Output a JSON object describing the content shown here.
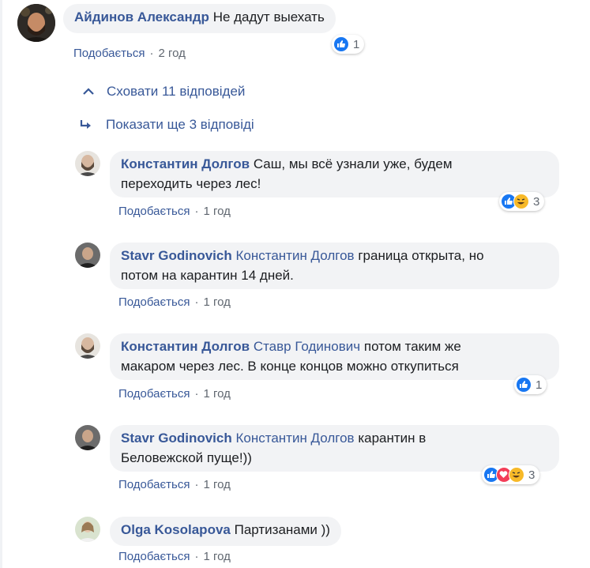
{
  "top_comment": {
    "name": "Айдинов Александр",
    "text": "Не дадут выехать",
    "like_label": "Подобається",
    "time": "2 год",
    "reaction_count": "1"
  },
  "thread": {
    "hide_label": "Сховати 11 відповідей",
    "more_label": "Показати ще 3 відповіді"
  },
  "replies": [
    {
      "name": "Константин Долгов",
      "line1": "Саш, мы всё узнали уже, будем",
      "line2": "переходить через лес!",
      "like_label": "Подобається",
      "time": "1 год",
      "reaction_count": "3"
    },
    {
      "name": "Stavr Godinovich",
      "mention": "Константин Долгов",
      "line1": "граница открыта, но",
      "line2": "потом на карантин 14 дней.",
      "like_label": "Подобається",
      "time": "1 год"
    },
    {
      "name": "Константин Долгов",
      "mention": "Ставр Годинович",
      "line1": "потом таким же",
      "line2": "макаром через лес. В конце концов можно откупиться",
      "like_label": "Подобається",
      "time": "1 год",
      "reaction_count": "1"
    },
    {
      "name": "Stavr Godinovich",
      "mention": "Константин Долгов",
      "line1": "карантин в",
      "line2": "Беловежской пуще!))",
      "like_label": "Подобається",
      "time": "1 год",
      "reaction_count": "3"
    },
    {
      "name": "Olga Kosolapova",
      "text": "Партизанами ))",
      "like_label": "Подобається",
      "time": "1 год"
    }
  ],
  "separator": "·",
  "colors": {
    "link": "#385898",
    "bubble": "#f2f3f5",
    "meta": "#606770",
    "like_blue": "#1877f2",
    "haha_yellow": "#f7b928",
    "love_red": "#f33e58"
  }
}
